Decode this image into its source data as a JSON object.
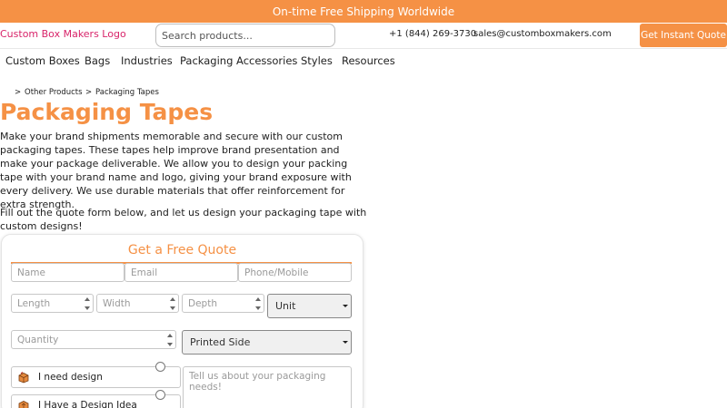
{
  "promo_bar": {
    "text": "On-time Free Shipping Worldwide"
  },
  "header": {
    "logo_text": "Custom Box Makers Logo",
    "search_placeholder": "Search products...",
    "phone": "+1 (844) 269-3730",
    "email": "sales@customboxmakers.com",
    "cta_label": "Get Instant Quote"
  },
  "nav": {
    "items": [
      "Custom Boxes",
      "Bags",
      "Industries",
      "Packaging Accessories",
      "Styles",
      "Resources"
    ]
  },
  "breadcrumb": {
    "separator": ">",
    "items": [
      "Other Products",
      "Packaging Tapes"
    ]
  },
  "page": {
    "title": "Packaging Tapes",
    "intro": "Make your brand shipments memorable and secure with our custom packaging tapes. These tapes help improve brand presentation and make your package deliverable. We allow you to design your packing tape with your brand name and logo, giving your brand exposure with every delivery. We use durable materials that offer reinforcement for extra strength.",
    "cta_text": "Fill out the quote form below, and let us design your packaging tape with custom designs!"
  },
  "quote_form": {
    "title": "Get a Free Quote",
    "name_placeholder": "Name",
    "email_placeholder": "Email",
    "phone_placeholder": "Phone/Mobile",
    "length_placeholder": "Length",
    "width_placeholder": "Width",
    "depth_placeholder": "Depth",
    "unit_select": "Unit",
    "quantity_placeholder": "Quantity",
    "printed_side_select": "Printed Side",
    "design_options": [
      "I need design",
      "I Have a Design Idea"
    ],
    "message_placeholder": "Tell us about your packaging needs!"
  },
  "colors": {
    "accent": "#f59145",
    "logo": "#d8246a"
  }
}
